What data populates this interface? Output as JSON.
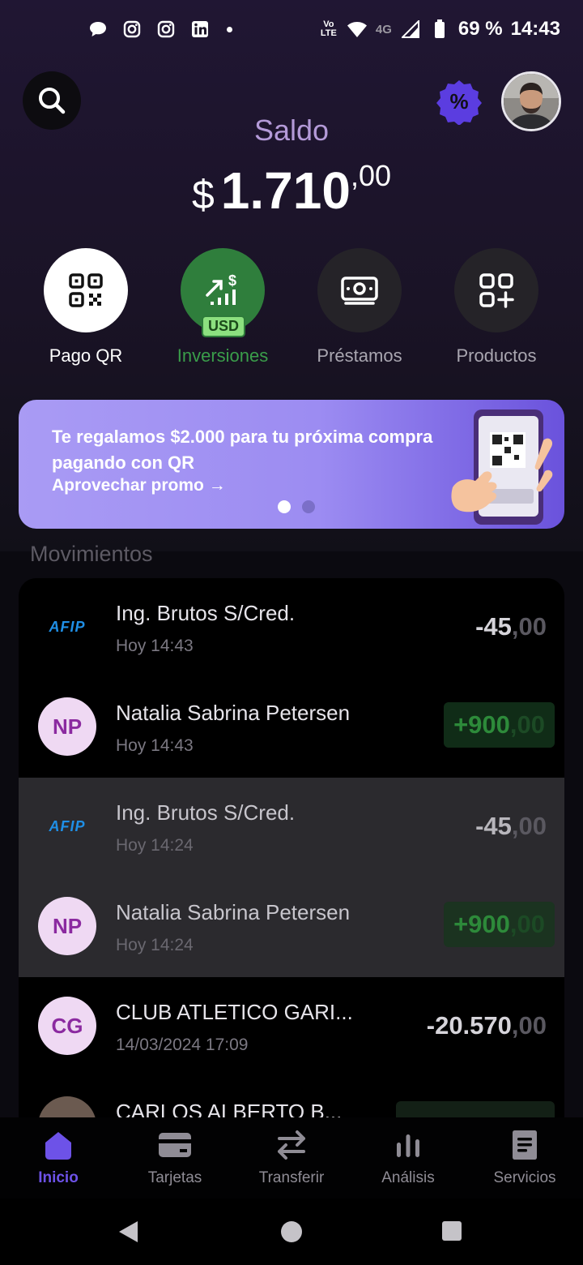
{
  "status_bar": {
    "battery": "69 %",
    "time": "14:43",
    "network": "4G",
    "volte": "Vo\nLTE"
  },
  "header": {
    "saldo_label": "Saldo",
    "currency": "$",
    "amount_int": "1.710",
    "amount_dec": ",00"
  },
  "actions": [
    {
      "label": "Pago QR",
      "icon": "qr-icon"
    },
    {
      "label": "Inversiones",
      "icon": "chart-up-icon",
      "tag": "USD"
    },
    {
      "label": "Préstamos",
      "icon": "cash-icon"
    },
    {
      "label": "Productos",
      "icon": "grid-plus-icon"
    }
  ],
  "banner": {
    "text": "Te regalamos $2.000 para tu próxima compra pagando con QR",
    "link": "Aprovechar promo →"
  },
  "movements": {
    "title": "Movimientos",
    "items": [
      {
        "logo": "AFIP",
        "name": "Ing. Brutos S/Cred.",
        "time": "Hoy 14:43",
        "amount_int": "-45",
        "amount_dec": ",00"
      },
      {
        "logo": "NP",
        "name": "Natalia Sabrina Petersen",
        "time": "Hoy 14:43",
        "amount_int": "+900",
        "amount_dec": ",00"
      },
      {
        "logo": "AFIP",
        "name": "Ing. Brutos S/Cred.",
        "time": "Hoy 14:24",
        "amount_int": "-45",
        "amount_dec": ",00"
      },
      {
        "logo": "NP",
        "name": "Natalia Sabrina Petersen",
        "time": "Hoy 14:24",
        "amount_int": "+900",
        "amount_dec": ",00"
      },
      {
        "logo": "CG",
        "name": "CLUB ATLETICO GARI...",
        "time": "14/03/2024 17:09",
        "amount_int": "-20.570",
        "amount_dec": ",00"
      },
      {
        "logo": "photo",
        "name": "CARLOS ALBERTO B...",
        "time": "",
        "amount_int": "",
        "amount_dec": ""
      }
    ]
  },
  "nav": [
    {
      "label": "Inicio",
      "icon": "home-icon"
    },
    {
      "label": "Tarjetas",
      "icon": "card-icon"
    },
    {
      "label": "Transferir",
      "icon": "transfer-icon"
    },
    {
      "label": "Análisis",
      "icon": "bars-icon"
    },
    {
      "label": "Servicios",
      "icon": "receipt-icon"
    }
  ],
  "colors": {
    "accent": "#6d52e8",
    "positive": "#2d8a3a",
    "saldo_label": "#b49ad8"
  }
}
